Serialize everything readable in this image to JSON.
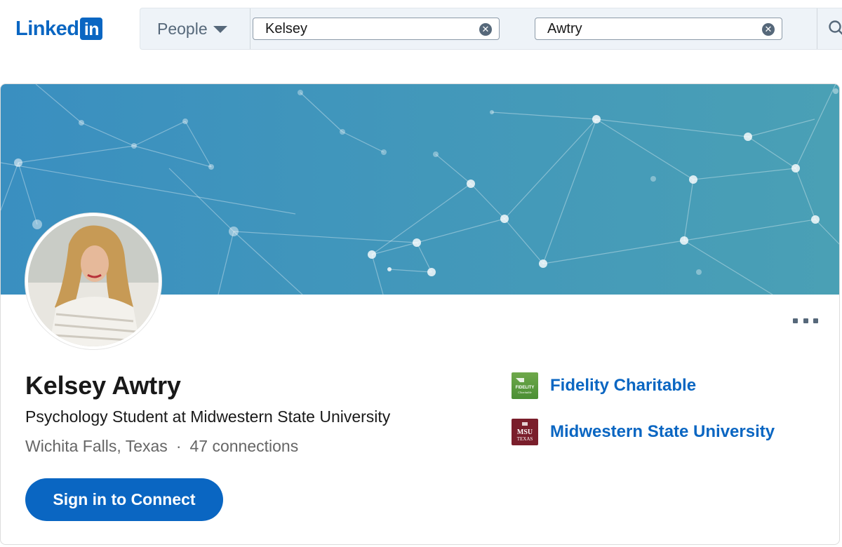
{
  "header": {
    "logo_text": "Linked",
    "logo_box": "in",
    "search": {
      "category": "People",
      "first_name": "Kelsey",
      "last_name": "Awtry"
    }
  },
  "profile": {
    "name": "Kelsey Awtry",
    "headline": "Psychology Student at Midwestern State University",
    "location": "Wichita Falls, Texas",
    "separator": "·",
    "connections": "47 connections",
    "connect_button": "Sign in to Connect"
  },
  "organizations": [
    {
      "name": "Fidelity Charitable",
      "logo_label": "FIDELITY",
      "logo_sub": "Charitable"
    },
    {
      "name": "Midwestern State University",
      "logo_label": "MSU",
      "logo_sub": "TEXAS"
    }
  ],
  "colors": {
    "brand": "#0a66c2",
    "banner_start": "#3a8fc0",
    "banner_end": "#4aa0b5"
  },
  "icons": {
    "search": "search-icon",
    "clear": "clear-icon",
    "caret": "chevron-down-icon",
    "more": "more-icon"
  }
}
